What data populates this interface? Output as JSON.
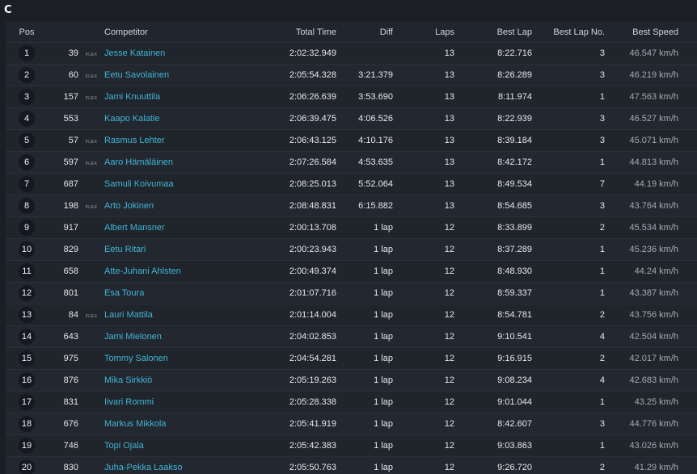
{
  "class_label": "C",
  "columns": {
    "pos": "Pos",
    "competitor": "Competitor",
    "total_time": "Total Time",
    "diff": "Diff",
    "laps": "Laps",
    "best_lap": "Best Lap",
    "best_lap_no": "Best Lap No.",
    "best_speed": "Best Speed"
  },
  "rows": [
    {
      "pos": "1",
      "num": "39",
      "flex": "FLEX",
      "name": "Jesse Katainen",
      "total": "2:02:32.949",
      "diff": "",
      "laps": "13",
      "best": "8:22.716",
      "bestno": "3",
      "speed": "46.547 km/h"
    },
    {
      "pos": "2",
      "num": "60",
      "flex": "FLEX",
      "name": "Eetu Savolainen",
      "total": "2:05:54.328",
      "diff": "3:21.379",
      "laps": "13",
      "best": "8:26.289",
      "bestno": "3",
      "speed": "46.219 km/h"
    },
    {
      "pos": "3",
      "num": "157",
      "flex": "FLEX",
      "name": "Jami Knuuttila",
      "total": "2:06:26.639",
      "diff": "3:53.690",
      "laps": "13",
      "best": "8:11.974",
      "bestno": "1",
      "speed": "47.563 km/h"
    },
    {
      "pos": "4",
      "num": "553",
      "flex": "",
      "name": "Kaapo Kalatie",
      "total": "2:06:39.475",
      "diff": "4:06.526",
      "laps": "13",
      "best": "8:22.939",
      "bestno": "3",
      "speed": "46.527 km/h"
    },
    {
      "pos": "5",
      "num": "57",
      "flex": "FLEX",
      "name": "Rasmus Lehter",
      "total": "2:06:43.125",
      "diff": "4:10.176",
      "laps": "13",
      "best": "8:39.184",
      "bestno": "3",
      "speed": "45.071 km/h"
    },
    {
      "pos": "6",
      "num": "597",
      "flex": "FLEX",
      "name": "Aaro Hämäläinen",
      "total": "2:07:26.584",
      "diff": "4:53.635",
      "laps": "13",
      "best": "8:42.172",
      "bestno": "1",
      "speed": "44.813 km/h"
    },
    {
      "pos": "7",
      "num": "687",
      "flex": "",
      "name": "Samuli Koivumaa",
      "total": "2:08:25.013",
      "diff": "5:52.064",
      "laps": "13",
      "best": "8:49.534",
      "bestno": "7",
      "speed": "44.19 km/h"
    },
    {
      "pos": "8",
      "num": "198",
      "flex": "FLEX",
      "name": "Arto Jokinen",
      "total": "2:08:48.831",
      "diff": "6:15.882",
      "laps": "13",
      "best": "8:54.685",
      "bestno": "3",
      "speed": "43.764 km/h"
    },
    {
      "pos": "9",
      "num": "917",
      "flex": "",
      "name": "Albert Mansner",
      "total": "2:00:13.708",
      "diff": "1 lap",
      "laps": "12",
      "best": "8:33.899",
      "bestno": "2",
      "speed": "45.534 km/h"
    },
    {
      "pos": "10",
      "num": "829",
      "flex": "",
      "name": "Eetu Ritari",
      "total": "2:00:23.943",
      "diff": "1 lap",
      "laps": "12",
      "best": "8:37.289",
      "bestno": "1",
      "speed": "45.236 km/h"
    },
    {
      "pos": "11",
      "num": "658",
      "flex": "",
      "name": "Atte-Juhani Ahlsten",
      "total": "2:00:49.374",
      "diff": "1 lap",
      "laps": "12",
      "best": "8:48.930",
      "bestno": "1",
      "speed": "44.24 km/h"
    },
    {
      "pos": "12",
      "num": "801",
      "flex": "",
      "name": "Esa Toura",
      "total": "2:01:07.716",
      "diff": "1 lap",
      "laps": "12",
      "best": "8:59.337",
      "bestno": "1",
      "speed": "43.387 km/h"
    },
    {
      "pos": "13",
      "num": "84",
      "flex": "FLEX",
      "name": "Lauri Mattila",
      "total": "2:01:14.004",
      "diff": "1 lap",
      "laps": "12",
      "best": "8:54.781",
      "bestno": "2",
      "speed": "43.756 km/h"
    },
    {
      "pos": "14",
      "num": "643",
      "flex": "",
      "name": "Jami Mielonen",
      "total": "2:04:02.853",
      "diff": "1 lap",
      "laps": "12",
      "best": "9:10.541",
      "bestno": "4",
      "speed": "42.504 km/h"
    },
    {
      "pos": "15",
      "num": "975",
      "flex": "",
      "name": "Tommy Salonen",
      "total": "2:04:54.281",
      "diff": "1 lap",
      "laps": "12",
      "best": "9:16.915",
      "bestno": "2",
      "speed": "42.017 km/h"
    },
    {
      "pos": "16",
      "num": "876",
      "flex": "",
      "name": "Mika Sirkkiö",
      "total": "2:05:19.263",
      "diff": "1 lap",
      "laps": "12",
      "best": "9:08.234",
      "bestno": "4",
      "speed": "42.683 km/h"
    },
    {
      "pos": "17",
      "num": "831",
      "flex": "",
      "name": "Iivari Rommi",
      "total": "2:05:28.338",
      "diff": "1 lap",
      "laps": "12",
      "best": "9:01.044",
      "bestno": "1",
      "speed": "43.25 km/h"
    },
    {
      "pos": "18",
      "num": "676",
      "flex": "",
      "name": "Markus Mikkola",
      "total": "2:05:41.919",
      "diff": "1 lap",
      "laps": "12",
      "best": "8:42.607",
      "bestno": "3",
      "speed": "44.776 km/h"
    },
    {
      "pos": "19",
      "num": "746",
      "flex": "",
      "name": "Topi Ojala",
      "total": "2:05:42.383",
      "diff": "1 lap",
      "laps": "12",
      "best": "9:03.863",
      "bestno": "1",
      "speed": "43.026 km/h"
    },
    {
      "pos": "20",
      "num": "830",
      "flex": "",
      "name": "Juha-Pekka Laakso",
      "total": "2:05:50.763",
      "diff": "1 lap",
      "laps": "12",
      "best": "9:26.720",
      "bestno": "2",
      "speed": "41.29 km/h"
    }
  ],
  "colors": {
    "background": "#1b1e25",
    "panel": "#21252d",
    "link": "#3fb6d8",
    "badge": "#151820"
  }
}
